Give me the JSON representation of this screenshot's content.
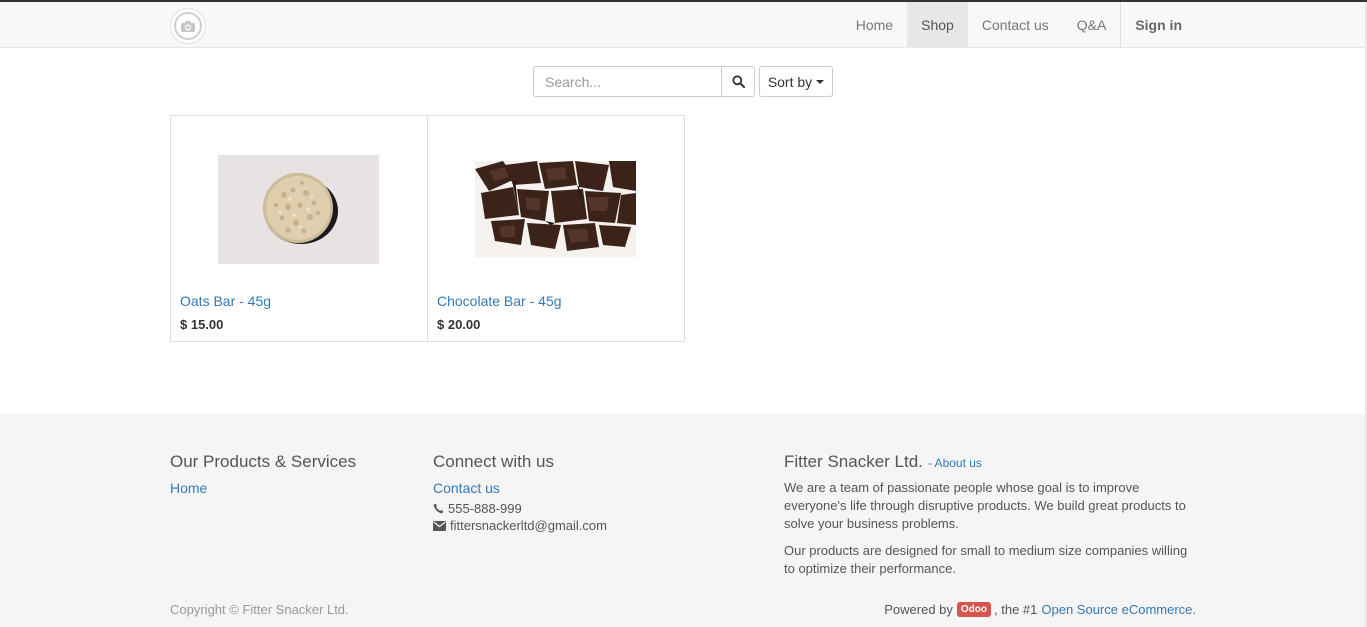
{
  "navbar": {
    "items": [
      {
        "label": "Home"
      },
      {
        "label": "Shop"
      },
      {
        "label": "Contact us"
      },
      {
        "label": "Q&A"
      }
    ],
    "signin_label": "Sign in"
  },
  "toolbar": {
    "search_placeholder": "Search...",
    "sort_label": "Sort by"
  },
  "products": [
    {
      "name": "Oats Bar - 45g",
      "price": "$ 15.00"
    },
    {
      "name": "Chocolate Bar - 45g",
      "price": "$ 20.00"
    }
  ],
  "footer": {
    "products_title": "Our Products & Services",
    "products_link": "Home",
    "connect_title": "Connect with us",
    "connect_link": "Contact us",
    "phone": "555-888-999",
    "email": "fittersnackerltd@gmail.com",
    "company_title": "Fitter Snacker Ltd.",
    "about_link": "- About us",
    "about_text_1": "We are a team of passionate people whose goal is to improve everyone's life through disruptive products. We build great products to solve your business problems.",
    "about_text_2": "Our products are designed for small to medium size companies willing to optimize their performance.",
    "copyright": "Copyright © Fitter Snacker Ltd.",
    "powered_prefix": "Powered by",
    "odoo_badge": "Odoo",
    "powered_middle": ", the #1",
    "powered_link": "Open Source eCommerce."
  },
  "colors": {
    "link": "#337ab7",
    "navbar_bg": "#f8f8f8",
    "footer_bg": "#f5f5f5",
    "odoo_badge": "#d9534f"
  },
  "icons": [
    "camera-logo-icon",
    "search-icon",
    "caret-down-icon",
    "phone-icon",
    "envelope-icon"
  ]
}
